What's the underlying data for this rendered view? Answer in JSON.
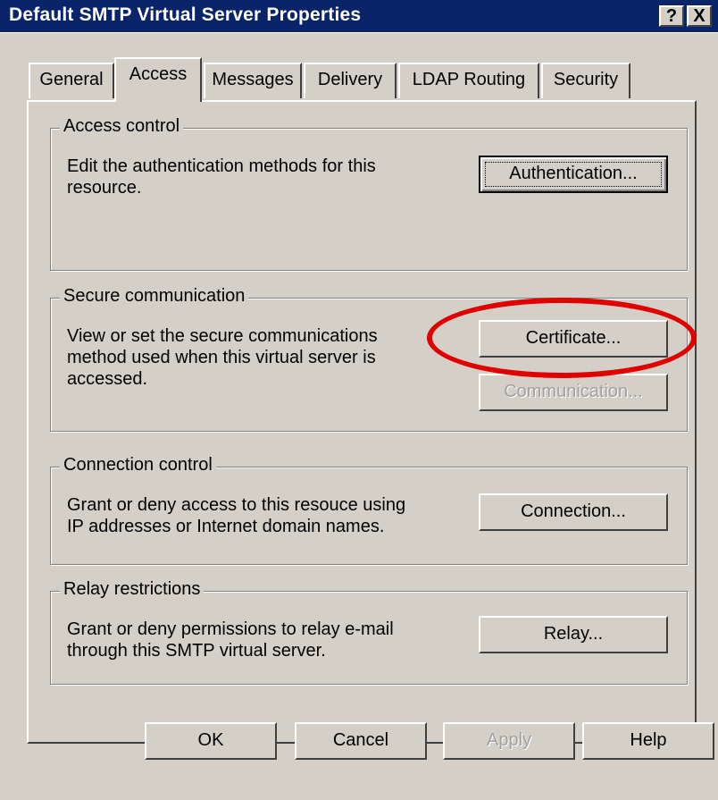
{
  "window": {
    "title": "Default SMTP Virtual Server Properties",
    "help_btn": "?",
    "close_btn": "X"
  },
  "tabs": [
    {
      "label": "General"
    },
    {
      "label": "Access",
      "active": true
    },
    {
      "label": "Messages"
    },
    {
      "label": "Delivery"
    },
    {
      "label": "LDAP Routing"
    },
    {
      "label": "Security"
    }
  ],
  "groups": {
    "access_control": {
      "title": "Access control",
      "text": "Edit the authentication methods for this\nresource.",
      "button": "Authentication..."
    },
    "secure_communication": {
      "title": "Secure communication",
      "text": "View or set the secure communications\nmethod used when this virtual server is\naccessed.",
      "button": "Certificate...",
      "button2": "Communication..."
    },
    "connection_control": {
      "title": "Connection control",
      "text": "Grant or deny access to this resouce using\nIP addresses or Internet domain names.",
      "button": "Connection..."
    },
    "relay_restrictions": {
      "title": "Relay restrictions",
      "text": "Grant or deny permissions to relay e-mail\nthrough this SMTP virtual server.",
      "button": "Relay..."
    }
  },
  "footer": {
    "ok": "OK",
    "cancel": "Cancel",
    "apply": "Apply",
    "help": "Help"
  },
  "colors": {
    "titlebar": "#0a246a",
    "dialog_bg": "#d4d0c8",
    "annotation": "#e00000"
  }
}
